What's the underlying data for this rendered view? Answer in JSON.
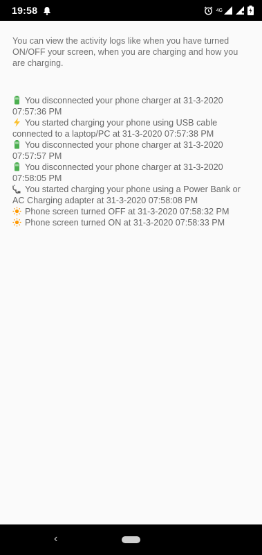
{
  "status_bar": {
    "time": "19:58",
    "network_label": "4G",
    "icons": [
      "notification-bell-icon",
      "alarm-icon",
      "signal-icon",
      "no-sim-signal-icon",
      "battery-charging-icon"
    ]
  },
  "intro_text": "You can view the activity logs like when you have turned ON/OFF your screen, when you are charging and how you are charging.",
  "logs": [
    {
      "icon": "battery-icon",
      "text": "You disconnected your phone charger at 31-3-2020 07:57:36 PM"
    },
    {
      "icon": "lightning-icon",
      "text": "You started charging your phone using USB cable connected to a laptop/PC at 31-3-2020 07:57:38 PM"
    },
    {
      "icon": "battery-icon",
      "text": "You disconnected your phone charger at 31-3-2020 07:57:57 PM"
    },
    {
      "icon": "battery-icon",
      "text": "You disconnected your phone charger at 31-3-2020 07:58:05 PM"
    },
    {
      "icon": "plug-icon",
      "text": "You started charging your phone using a Power Bank or AC Charging adapter at 31-3-2020 07:58:08 PM"
    },
    {
      "icon": "sun-icon",
      "text": "Phone screen turned OFF at 31-3-2020 07:58:32 PM"
    },
    {
      "icon": "sun-icon",
      "text": "Phone screen turned ON at 31-3-2020 07:58:33 PM"
    }
  ],
  "colors": {
    "background": "#fafafa",
    "text": "#707070",
    "battery": "#4caf50",
    "lightning": "#fbc02d",
    "sun": "#ff9800",
    "plug": "#555555"
  }
}
